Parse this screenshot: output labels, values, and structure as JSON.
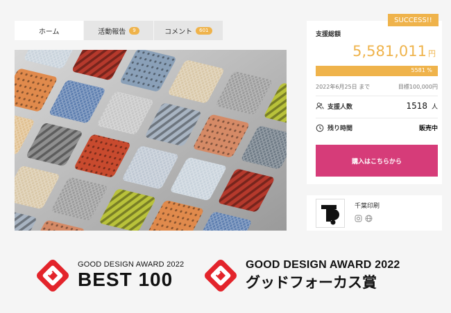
{
  "tabs": [
    {
      "label": "ホーム",
      "badge": ""
    },
    {
      "label": "活動報告",
      "badge": "9"
    },
    {
      "label": "コメント",
      "badge": "601"
    }
  ],
  "status_badge": "SUCCESS!!",
  "funding": {
    "total_label": "支援総額",
    "amount": "5,581,011",
    "currency": "円",
    "percent_text": "5581 %",
    "percent": 5581,
    "deadline": "2022年6月25日 まで",
    "goal": "目標100,000円"
  },
  "supporters": {
    "label": "支援人数",
    "value": "1518",
    "unit": "人"
  },
  "remaining": {
    "label": "残り時間",
    "value": "販売中"
  },
  "buy_button": "購入はこちらから",
  "author": {
    "name": "千葉印刷"
  },
  "awards": [
    {
      "subtitle": "GOOD DESIGN AWARD 2022",
      "title": "BEST 100"
    },
    {
      "subtitle": "GOOD DESIGN AWARD 2022",
      "title": "グッドフォーカス賞"
    }
  ],
  "colors": {
    "accent": "#efb34b",
    "buy": "#d63c79",
    "award_red": "#e3242b"
  },
  "icons": {
    "supporters": "users-icon",
    "remaining": "clock-icon",
    "author_social": [
      "instagram-icon",
      "globe-icon"
    ]
  }
}
